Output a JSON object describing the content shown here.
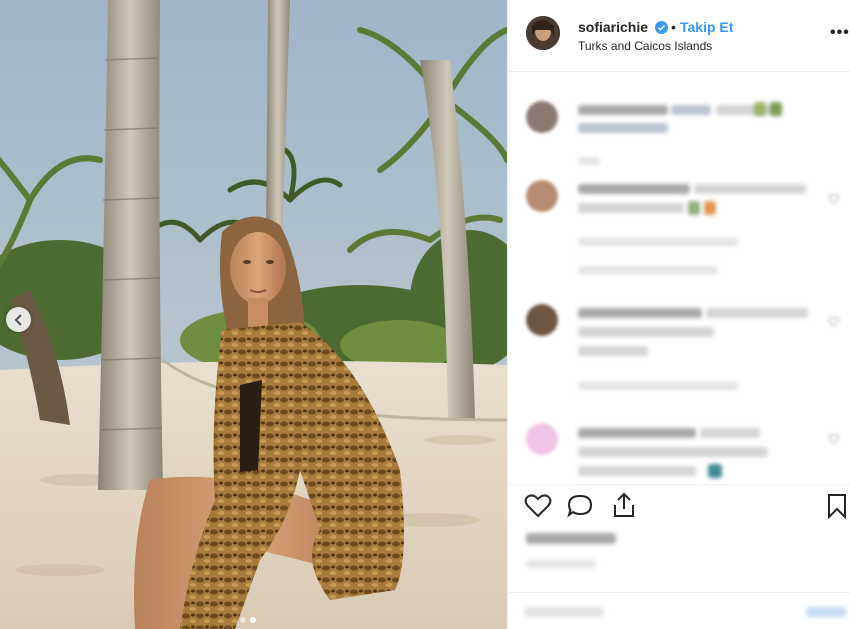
{
  "header": {
    "username": "sofiarichie",
    "separator": "•",
    "follow_label": "Takip Et",
    "location": "Turks and Caicos Islands",
    "more_label": "•••"
  },
  "carousel": {
    "slide_count": 2,
    "active_index": 1
  }
}
